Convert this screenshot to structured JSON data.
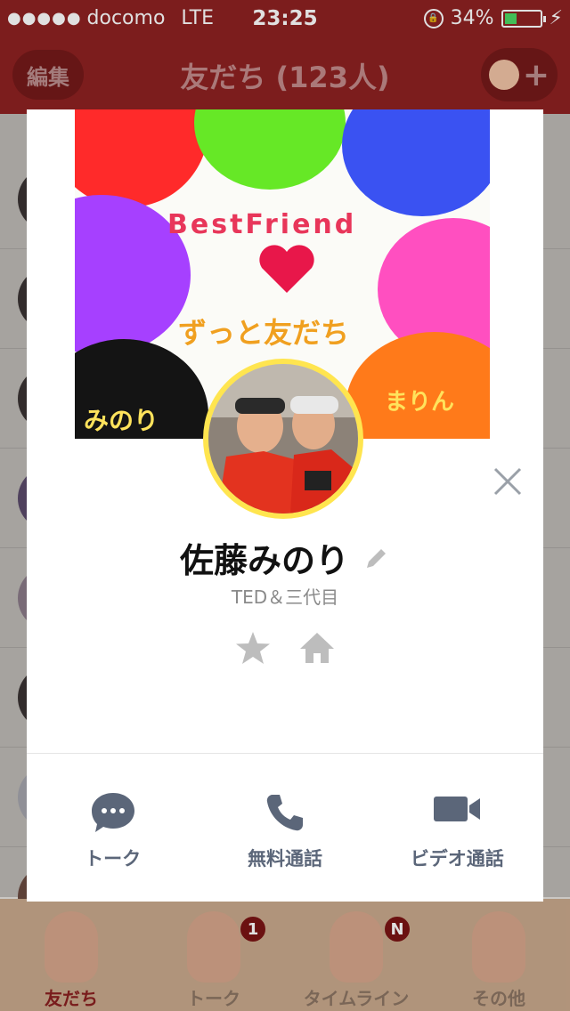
{
  "status_bar": {
    "signal": "●●●●●",
    "carrier": "docomo",
    "network": "LTE",
    "time": "23:25",
    "battery": "34%",
    "battery_level": 0.34
  },
  "header": {
    "edit_label": "編集",
    "title": "友だち (123人)",
    "add_friend": "+"
  },
  "profile": {
    "name": "佐藤みのり",
    "status_message": "TED＆三代目",
    "cover_texts": {
      "best_friend": "BestFriend",
      "zutto": "ずっと友だち",
      "minori": "みのり",
      "marin": "まりん"
    }
  },
  "actions": [
    {
      "label": "トーク",
      "icon": "chat-bubble-icon"
    },
    {
      "label": "無料通話",
      "icon": "phone-icon"
    },
    {
      "label": "ビデオ通話",
      "icon": "video-camera-icon"
    }
  ],
  "tabs": [
    {
      "label": "友だち",
      "active": true,
      "badge": ""
    },
    {
      "label": "トーク",
      "active": false,
      "badge": "1"
    },
    {
      "label": "タイムライン",
      "active": false,
      "badge": "N"
    },
    {
      "label": "その他",
      "active": false,
      "badge": ""
    }
  ],
  "colors": {
    "header_red": "#8e2121",
    "action_icon": "#5b6679",
    "star_gray": "#bdbdbd"
  }
}
